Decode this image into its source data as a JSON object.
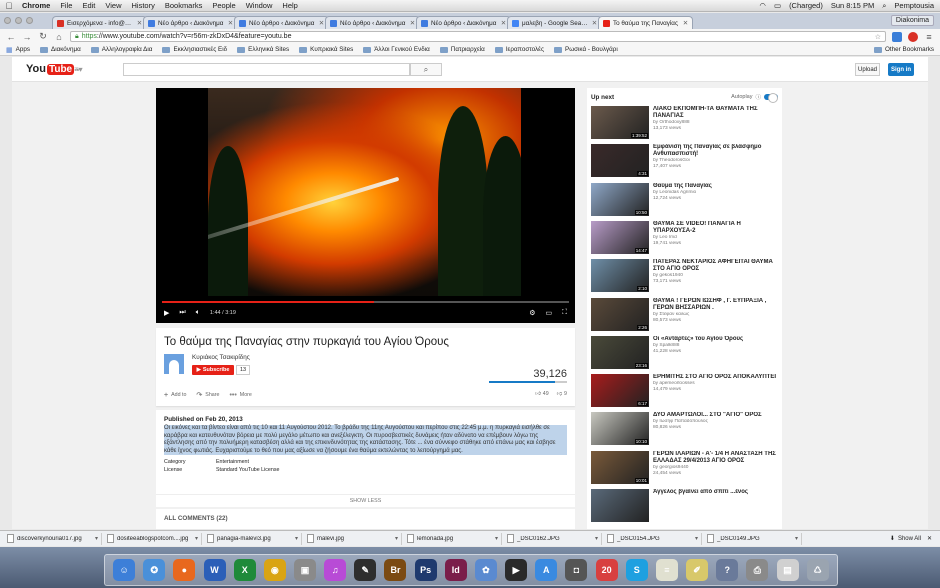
{
  "menubar": {
    "apple": "",
    "app": "Chrome",
    "items": [
      "File",
      "Edit",
      "View",
      "History",
      "Bookmarks",
      "People",
      "Window",
      "Help"
    ],
    "battery": "(Charged)",
    "clock": "Sun 8:15 PM",
    "user": "Pemptousia"
  },
  "tabs": [
    {
      "title": "Εισερχόμενα - info@diako",
      "color": "#d93025"
    },
    {
      "title": "Νέο άρθρο ‹ Διακόνημα",
      "color": "#3f7be0"
    },
    {
      "title": "Νέο άρθρο ‹ Διακόνημα",
      "color": "#3f7be0"
    },
    {
      "title": "Νέο άρθρο ‹ Διακόνημα",
      "color": "#3f7be0"
    },
    {
      "title": "Νέο άρθρο ‹ Διακόνημα",
      "color": "#3f7be0"
    },
    {
      "title": "μαλεβη - Google Search",
      "color": "#4285f4"
    },
    {
      "title": "Το θαύμα της Παναγίας",
      "color": "#e62117"
    }
  ],
  "profile_name": "Diakonima",
  "toolbar": {
    "url_scheme": "https",
    "url_rest": "://www.youtube.com/watch?v=r56m-zkDxD4&feature=youtu.be"
  },
  "bookmarks": {
    "items": [
      "Apps",
      "Διακόνημα",
      "Αλληλογραφία Δια",
      "Εκκλησιαστικές Ειδ",
      "Ελληνικά Sites",
      "Κυπριακά Sites",
      "Άλλοι Γενικού Ενδια",
      "Πατριαρχεία",
      "Ιεραποστολές",
      "Ρωσικά - Βουλγάρι"
    ],
    "other": "Other Bookmarks"
  },
  "youtube": {
    "logo_you": "You",
    "logo_tube": "Tube",
    "logo_region": "GR",
    "search_placeholder": "",
    "upload_label": "Upload",
    "signin_label": "Sign in"
  },
  "player": {
    "time": "1:44 / 3:19",
    "progress": 0.52
  },
  "video": {
    "title": "Το θαύμα της Παναγίας στην πυρκαγιά του Αγίου Όρους",
    "channel": "Κυριάκος Τσακιρίδης",
    "subscribe_label": "Subscribe",
    "subscribers": "13",
    "views": "39,126",
    "like_ratio": 0.84,
    "add_to": "Add to",
    "share": "Share",
    "more": "More",
    "likes": "49",
    "dislikes": "9"
  },
  "description": {
    "published": "Published on Feb 20, 2013",
    "text": "Οι εικόνες και τα βίντεο είναι από τις 10 και 11 Αυγούστου 2012. Το βράδυ της 11ης Αυγούστου και περίπου στις 22:45 μ.μ. η πυρκαγιά εισήλθε σε καράβρα και κατευθυνόταν βόρεια με πολύ μεγάλο μέτωπο και ανεξέλεγκτη. Οι πυροσβεστικές δυνάμεις ήταν αδύνατο να επέμβουν λόγω της εξάντλησης από την πολυήμερη κατασβέση αλλά και της επικινδυνότητας της κατάστασης. Τότε ... ένα σύννεφο στάθηκε από επάνω μας και έσβησε κάθε ίχνος φωτιάς. Ευχαριστούμε το θεό που μας αξίωσε να ζήσουμε ένα θαύμα εκτελώντας το λειτούργημά μας.",
    "category_label": "Category",
    "category_value": "Entertainment",
    "license_label": "License",
    "license_value": "Standard YouTube License",
    "show_less": "SHOW LESS"
  },
  "comments_header": "ALL COMMENTS (22)",
  "sidebar": {
    "up_next": "Up next",
    "autoplay": "Autoplay",
    "items": [
      {
        "title": "ΛΙΑΚΟ ΕΚΠΟΜΠΗ-ΤΑ ΘΑΥΜΑΤΑ ΤΗΣ ΠΑΝΑΓΙΑΣ",
        "by": "by Orthodoxy888",
        "views": "13,173 views",
        "dur": "1:39:52",
        "color": "#6b5a4c"
      },
      {
        "title": "Εμφάνιση της Παναγίας σε βλάσφημο Ανθυπασπιστή!",
        "by": "by TheodorosGoi",
        "views": "17,407 views",
        "dur": "4:31",
        "color": "#3a2a2a"
      },
      {
        "title": "Θαύμα της Παναγίας",
        "by": "by Leonidas Agrimio",
        "views": "12,724 views",
        "dur": "10:50",
        "color": "#8fa8c8"
      },
      {
        "title": "ΘΑΥΜΑ ΣΕ VIDEO! ΠΑΝΑΓΙΑ Η ΥΠΑΡΧΟΥΣΑ-2",
        "by": "by Leo Imd",
        "views": "19,741 views",
        "dur": "14:47",
        "color": "#b89cc8"
      },
      {
        "title": "ΠΑΤΕΡΑΣ ΝΕΚΤΑΡΙΟΣ ΑΦΗΓΕΙΤΑΙ ΘΑΥΜΑ ΣΤΟ ΑΓΙΟ ΟΡΟΣ",
        "by": "by gekos1940",
        "views": "73,171 views",
        "dur": "2:10",
        "color": "#6f8fa8"
      },
      {
        "title": "ΘΑΥΜΑ ! ΓΕΡΩΝ ΙΩΣΗΦ , Γ. ΕΥΠΡΑΞΙΑ , ΓΕΡΩΝ ΒΗΣΣΑΡΙΩΝ .",
        "by": "by Στέφαν καλώς",
        "views": "80,573 views",
        "dur": "2:26",
        "color": "#5a4a3a"
      },
      {
        "title": "Οι «Αντάρτες» του Αγίου Όρους",
        "by": "by Spalk888",
        "views": "41,228 views",
        "dur": "23:16",
        "color": "#4a4a3a"
      },
      {
        "title": "ΕΡΗΜΙΤΗΣ ΣΤΟ ΑΓΙΟ ΟΡΟΣ ΑΠΟΚΑΛΥΠΤΕΙ",
        "by": "by apemeorloosses",
        "views": "14,479 views",
        "dur": "6:17",
        "color": "#a81c1c"
      },
      {
        "title": "ΔΥΟ ΑΜΑΡΤΩΛΟΙ... ΣΤΟ \"ΑΓΙΟ\" ΟΡΟΣ",
        "by": "by Ιωσήφ Παπαδόπουλος",
        "views": "80,826 views",
        "dur": "10:10",
        "color": "#c8c8c0"
      },
      {
        "title": "ΓΕΡΩΝ ΙΛΑΡΙΩΝ - Α'- 1/4 Η ΑΝΑΣΤΑΣΗ ΤΗΣ ΕΛΛΑΔΑΣ 29/4/2013 ΑΓΙΟ ΟΡΟΣ",
        "by": "by georgios9440",
        "views": "24,454 views",
        "dur": "10:01",
        "color": "#7a5a3a"
      },
      {
        "title": "Άγγελος βγαίνει από σπίτι ...ένος",
        "by": "",
        "views": "",
        "dur": "",
        "color": "#5a6a7a"
      }
    ]
  },
  "downloads": {
    "items": [
      "discoverkynouria017.jpg",
      "dositeeablogspotcom....jpg",
      "panagia-malevi3.jpg",
      "malevi.jpg",
      "lemonada.jpg",
      "_DSC0162.JPG",
      "_DSC0154.JPG",
      "_DSC0149.JPG"
    ],
    "show_all": "Show All"
  },
  "dock": {
    "icons": [
      {
        "name": "finder-icon",
        "color": "#3d7fd8",
        "glyph": "☺"
      },
      {
        "name": "safari-icon",
        "color": "#4a90d9",
        "glyph": "✪"
      },
      {
        "name": "firefox-icon",
        "color": "#e8681e",
        "glyph": "●"
      },
      {
        "name": "word-icon",
        "color": "#2b5fb8",
        "glyph": "W"
      },
      {
        "name": "excel-icon",
        "color": "#1f8a3a",
        "glyph": "X"
      },
      {
        "name": "chrome-icon",
        "color": "#d9a413",
        "glyph": "◉"
      },
      {
        "name": "preview-icon",
        "color": "#8a8a8a",
        "glyph": "▣"
      },
      {
        "name": "itunes-icon",
        "color": "#b84bd6",
        "glyph": "♫"
      },
      {
        "name": "artrage-icon",
        "color": "#2e2e2e",
        "glyph": "✎"
      },
      {
        "name": "bridge-icon",
        "color": "#7b4a12",
        "glyph": "Br"
      },
      {
        "name": "photoshop-icon",
        "color": "#1f3a6e",
        "glyph": "Ps"
      },
      {
        "name": "indesign-icon",
        "color": "#7a1e4a",
        "glyph": "Id"
      },
      {
        "name": "photos-icon",
        "color": "#5a8ad0",
        "glyph": "✿"
      },
      {
        "name": "video-icon",
        "color": "#2a2a2a",
        "glyph": "▶"
      },
      {
        "name": "appstore-icon",
        "color": "#3a8ae0",
        "glyph": "A"
      },
      {
        "name": "camera-icon",
        "color": "#555555",
        "glyph": "◘"
      },
      {
        "name": "calendar-icon",
        "color": "#d84040",
        "glyph": "20"
      },
      {
        "name": "skype-icon",
        "color": "#1ea0e0",
        "glyph": "S"
      },
      {
        "name": "textedit-icon",
        "color": "#e0e0d0",
        "glyph": "≡"
      },
      {
        "name": "notes-icon",
        "color": "#d8c86a",
        "glyph": "✐"
      },
      {
        "name": "help-icon",
        "color": "#6a7a9a",
        "glyph": "?"
      },
      {
        "name": "printer-icon",
        "color": "#8a8a8a",
        "glyph": "⎙"
      },
      {
        "name": "image-file-icon",
        "color": "#d0d0d0",
        "glyph": "▤"
      },
      {
        "name": "trash-icon",
        "color": "#9aa4b0",
        "glyph": "♺"
      }
    ]
  }
}
